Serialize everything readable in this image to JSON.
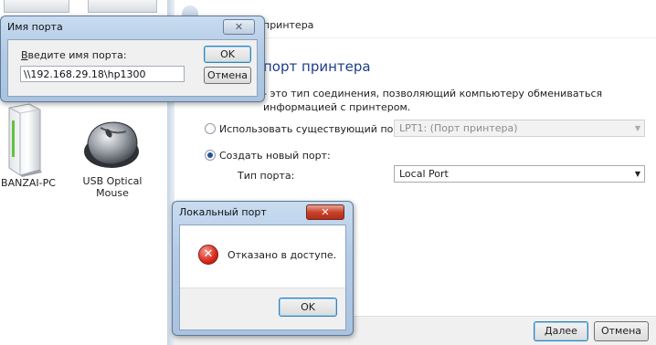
{
  "explorer": {
    "devices": [
      {
        "name": "BANZAI-PC",
        "icon": "computer-icon"
      },
      {
        "name": "USB Optical Mouse",
        "icon": "mouse-icon"
      }
    ]
  },
  "wizard": {
    "title": "принтера",
    "heading": "порт принтера",
    "description": "- это тип соединения, позволяющий компьютеру обмениваться информацией с принтером.",
    "use_existing_label": "Использовать существующий порт:",
    "existing_port_value": "LPT1: (Порт принтера)",
    "create_new_label": "Создать новый порт:",
    "port_type_label": "Тип порта:",
    "port_type_value": "Local Port",
    "selected_option": "create_new",
    "next_button": "Далее",
    "cancel_button": "Отмена"
  },
  "port_name_dialog": {
    "title": "Имя порта",
    "prompt": "Введите имя порта:",
    "prompt_hotkey_char": "В",
    "prompt_rest": "ведите имя порта:",
    "value": "\\\\192.168.29.18\\hp1300",
    "ok_button": "OK",
    "cancel_button": "Отмена"
  },
  "error_dialog": {
    "title": "Локальный порт",
    "message": "Отказано в доступе.",
    "ok_button": "OK",
    "icon": "error-icon"
  },
  "colors": {
    "heading_blue": "#1c3d8c",
    "frame_blue": "#b3cbe6",
    "close_red": "#c8432b",
    "error_red": "#d6291c"
  }
}
